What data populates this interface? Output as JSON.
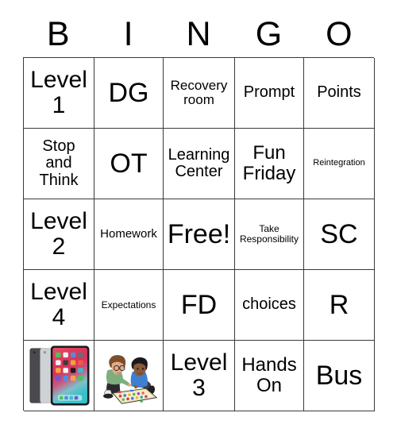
{
  "header": {
    "letters": [
      "B",
      "I",
      "N",
      "G",
      "O"
    ]
  },
  "grid": {
    "rows": [
      [
        {
          "text": "Level\n1",
          "size": "fs-lg",
          "type": "text"
        },
        {
          "text": "DG",
          "size": "fs-xl",
          "type": "text"
        },
        {
          "text": "Recovery\nroom",
          "size": "fs-xs",
          "type": "text"
        },
        {
          "text": "Prompt",
          "size": "fs-sm",
          "type": "text"
        },
        {
          "text": "Points",
          "size": "fs-sm",
          "type": "text"
        }
      ],
      [
        {
          "text": "Stop\nand\nThink",
          "size": "fs-sm",
          "type": "text"
        },
        {
          "text": "OT",
          "size": "fs-xl",
          "type": "text"
        },
        {
          "text": "Learning\nCenter",
          "size": "fs-sm",
          "type": "text"
        },
        {
          "text": "Fun\nFriday",
          "size": "fs-md",
          "type": "text"
        },
        {
          "text": "Reintegration",
          "size": "fs-micro",
          "type": "text"
        }
      ],
      [
        {
          "text": "Level\n2",
          "size": "fs-lg",
          "type": "text"
        },
        {
          "text": "Homework",
          "size": "fs-xxs",
          "type": "text"
        },
        {
          "text": "Free!",
          "size": "fs-xl",
          "type": "text"
        },
        {
          "text": "Take\nResponsibility",
          "size": "fs-tiny",
          "type": "text"
        },
        {
          "text": "SC",
          "size": "fs-xl",
          "type": "text"
        }
      ],
      [
        {
          "text": "Level\n4",
          "size": "fs-lg",
          "type": "text"
        },
        {
          "text": "Expectations",
          "size": "fs-tiny",
          "type": "text"
        },
        {
          "text": "FD",
          "size": "fs-xl",
          "type": "text"
        },
        {
          "text": "choices",
          "size": "fs-sm",
          "type": "text"
        },
        {
          "text": "R",
          "size": "fs-xl",
          "type": "text"
        }
      ],
      [
        {
          "text": "",
          "size": "",
          "type": "image",
          "image": "ipads-photo"
        },
        {
          "text": "",
          "size": "",
          "type": "image",
          "image": "kids-playing-board-game-clipart"
        },
        {
          "text": "Level\n3",
          "size": "fs-lg",
          "type": "text"
        },
        {
          "text": "Hands\nOn",
          "size": "fs-md",
          "type": "text"
        },
        {
          "text": "Bus",
          "size": "fs-xl",
          "type": "text"
        }
      ]
    ]
  },
  "colors": {
    "border": "#3a3a3a",
    "background": "#ffffff",
    "text": "#000000"
  }
}
